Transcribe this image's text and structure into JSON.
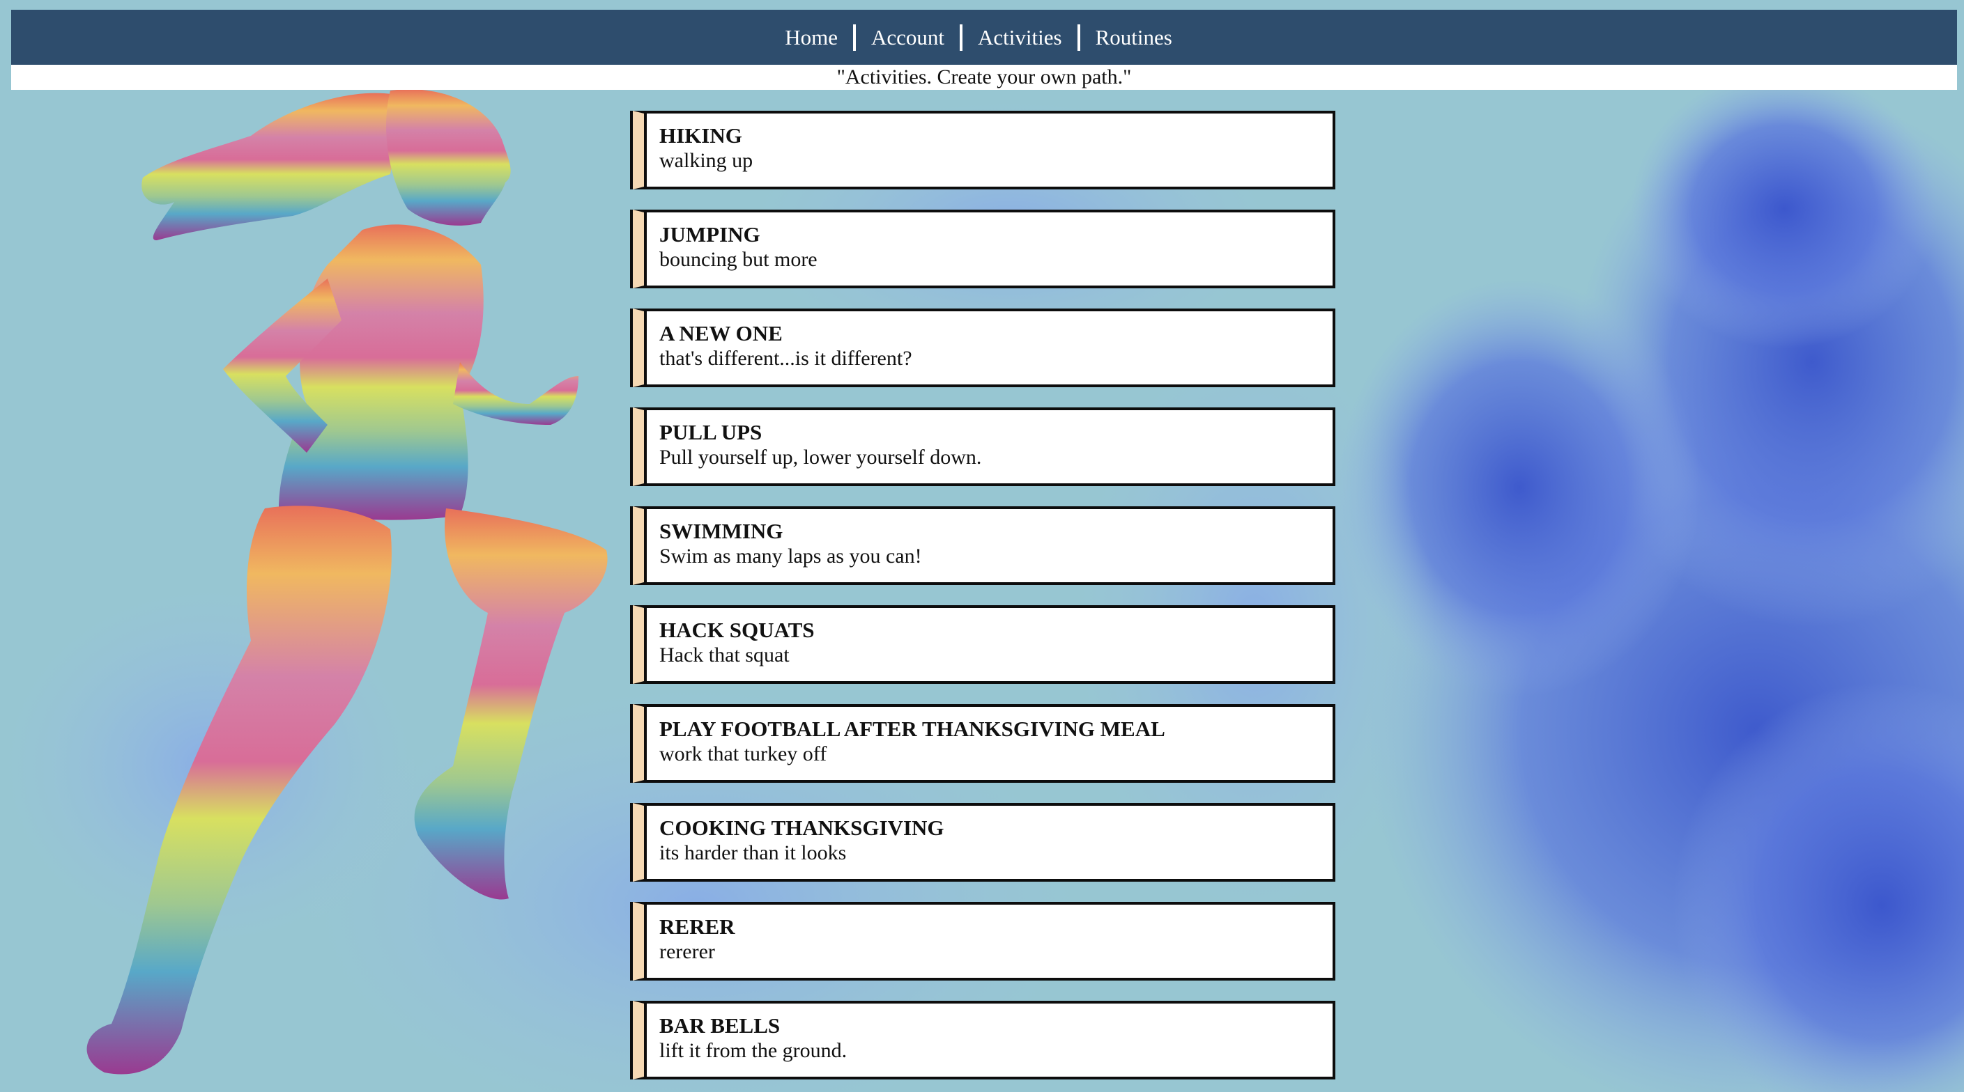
{
  "nav": {
    "items": [
      {
        "label": "Home"
      },
      {
        "label": "Account"
      },
      {
        "label": "Activities"
      },
      {
        "label": "Routines"
      }
    ]
  },
  "tagline": "\"Activities. Create your own path.\"",
  "activities": [
    {
      "name": "HIKING",
      "description": "walking up"
    },
    {
      "name": "JUMPING",
      "description": "bouncing but more"
    },
    {
      "name": "A NEW ONE",
      "description": "that's different...is it different?"
    },
    {
      "name": "PULL UPS",
      "description": "Pull yourself up, lower yourself down."
    },
    {
      "name": "SWIMMING",
      "description": "Swim as many laps as you can!"
    },
    {
      "name": "HACK SQUATS",
      "description": "Hack that squat"
    },
    {
      "name": "PLAY FOOTBALL AFTER THANKSGIVING MEAL",
      "description": "work that turkey off"
    },
    {
      "name": "COOKING THANKSGIVING",
      "description": "its harder than it looks"
    },
    {
      "name": "RERER",
      "description": "rererer"
    },
    {
      "name": "BAR BELLS",
      "description": "lift it from the ground."
    }
  ],
  "colors": {
    "background": "#97c6d2",
    "nav_bar": "#2e4d6d",
    "card_accent": "#f6d9b4",
    "smoke_blue": "#4f6fd9"
  }
}
